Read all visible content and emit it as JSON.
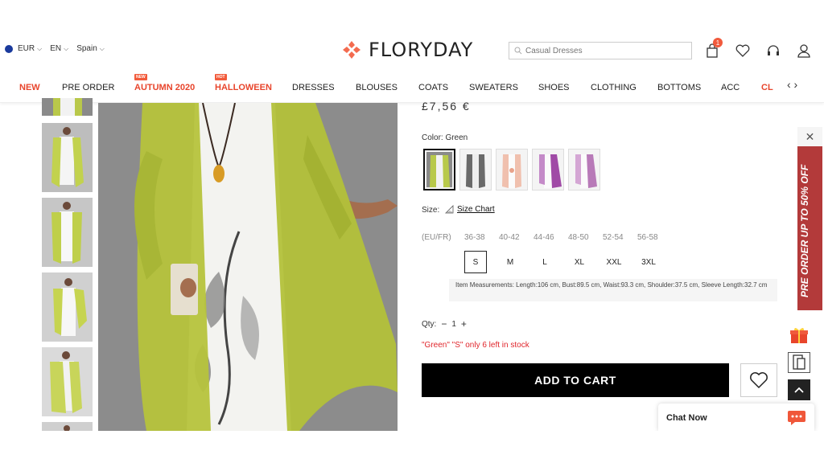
{
  "topbar": {
    "currency": "EUR",
    "language": "EN",
    "country": "Spain",
    "brand": "FLORYDAY",
    "search_placeholder": "Casual Dresses",
    "cart_count": "1"
  },
  "nav": {
    "items": [
      {
        "label": "NEW",
        "tag": ""
      },
      {
        "label": "PRE ORDER",
        "tag": ""
      },
      {
        "label": "AUTUMN 2020",
        "tag": "NEW"
      },
      {
        "label": "HALLOWEEN",
        "tag": "HOT"
      },
      {
        "label": "DRESSES",
        "tag": ""
      },
      {
        "label": "BLOUSES",
        "tag": ""
      },
      {
        "label": "COATS",
        "tag": ""
      },
      {
        "label": "SWEATERS",
        "tag": ""
      },
      {
        "label": "SHOES",
        "tag": ""
      },
      {
        "label": "CLOTHING",
        "tag": ""
      },
      {
        "label": "BOTTOMS",
        "tag": ""
      },
      {
        "label": "ACC",
        "tag": ""
      },
      {
        "label": "CL",
        "tag": ""
      }
    ],
    "arrows": "‹ ›"
  },
  "product": {
    "price": "£7,56 €",
    "color_label": "Color: Green",
    "size_label": "Size:",
    "size_chart": "Size Chart",
    "eu_label": "(EU/FR)",
    "eu_sizes": [
      "36-38",
      "40-42",
      "44-46",
      "48-50",
      "52-54",
      "56-58"
    ],
    "sizes": [
      "S",
      "M",
      "L",
      "XL",
      "XXL",
      "3XL"
    ],
    "selected_size": "S",
    "measurements": "Item Measurements: Length:106 cm, Bust:89.5 cm, Waist:93.3 cm, Shoulder:37.5 cm, Sleeve Length:32.7 cm",
    "qty_label": "Qty:",
    "qty_minus": "−",
    "qty_value": "1",
    "qty_plus": "+",
    "stock_text": "\"Green\"  \"S\"  only 6 left in stock",
    "add_to_cart": "ADD TO CART",
    "swatch_colors": [
      "#b8c94a",
      "#6a6a6a",
      "#e8a28a",
      "#a04aa6",
      "#b87ab8"
    ]
  },
  "promo": {
    "text": "PRE ORDER UP TO 50% OFF",
    "close": "✕"
  },
  "chat": {
    "label": "Chat Now"
  },
  "colors": {
    "accent_red": "#e8452c",
    "promo_bg": "#b33a3a",
    "button_bg": "#000000"
  }
}
